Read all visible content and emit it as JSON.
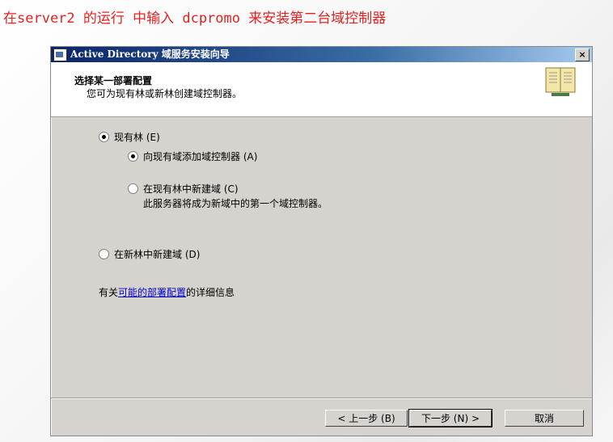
{
  "caption": "在server2 的运行 中输入 dcpromo 来安装第二台域控制器",
  "window": {
    "title": "Active Directory 域服务安装向导",
    "close_label": "×"
  },
  "header": {
    "title": "选择某一部署配置",
    "subtitle": "您可为现有林或新林创建域控制器。"
  },
  "options": {
    "existing_forest": "现有林 (E)",
    "add_dc": "向现有域添加域控制器 (A)",
    "new_domain_in_existing": "在现有林中新建域 (C)",
    "new_domain_desc": "此服务器将成为新域中的第一个域控制器。",
    "new_forest": "在新林中新建域 (D)"
  },
  "info": {
    "prefix": "有关",
    "link": "可能的部署配置",
    "suffix": "的详细信息"
  },
  "buttons": {
    "back": "< 上一步 (B)",
    "next": "下一步 (N) >",
    "cancel": "取消"
  },
  "colors": {
    "caption": "#e8201e",
    "titlebar_start": "#0a246a",
    "link": "#0000cc"
  }
}
